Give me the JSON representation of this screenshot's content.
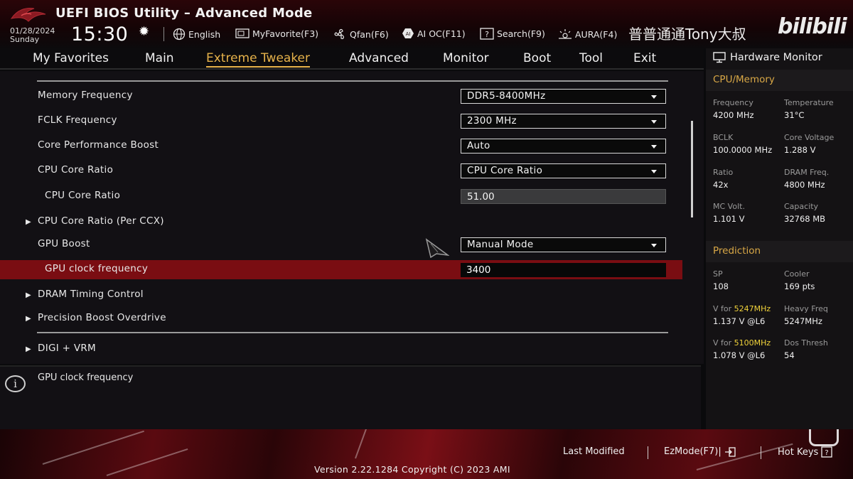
{
  "header": {
    "title": "UEFI BIOS Utility – Advanced Mode",
    "date": "01/28/2024",
    "day": "Sunday",
    "time": "15:30",
    "tools": [
      {
        "label": "English",
        "icon": "globe-icon"
      },
      {
        "label": "MyFavorite(F3)",
        "icon": "favorite-icon"
      },
      {
        "label": "Qfan(F6)",
        "icon": "fan-icon"
      },
      {
        "label": "AI OC(F11)",
        "icon": "ai-oc-icon"
      },
      {
        "label": "Search(F9)",
        "icon": "search-icon"
      },
      {
        "label": "AURA(F4)",
        "icon": "aura-icon"
      }
    ],
    "watermark": "普普通通Tony大叔",
    "watermark_logo": "bilibili"
  },
  "nav": {
    "tabs": [
      "My Favorites",
      "Main",
      "Extreme Tweaker",
      "Advanced",
      "Monitor",
      "Boot",
      "Tool",
      "Exit"
    ],
    "active": "Extreme Tweaker"
  },
  "settings": {
    "memory_frequency": {
      "label": "Memory Frequency",
      "value": "DDR5-8400MHz"
    },
    "fclk_frequency": {
      "label": "FCLK Frequency",
      "value": "2300 MHz"
    },
    "core_performance_boost": {
      "label": "Core Performance Boost",
      "value": "Auto"
    },
    "cpu_core_ratio": {
      "label": "CPU Core Ratio",
      "value": "CPU Core Ratio"
    },
    "cpu_core_ratio_sub": {
      "label": "CPU Core Ratio",
      "value": "51.00"
    },
    "cpu_core_ratio_per_ccx": {
      "label": "CPU Core Ratio (Per CCX)"
    },
    "gpu_boost": {
      "label": "GPU Boost",
      "value": "Manual Mode"
    },
    "gpu_clock_frequency": {
      "label": "GPU clock frequency",
      "value": "3400"
    },
    "dram_timing_control": {
      "label": "DRAM Timing Control"
    },
    "precision_boost_overdrive": {
      "label": "Precision Boost Overdrive"
    },
    "digi_vrm": {
      "label": "DIGI + VRM"
    }
  },
  "help": {
    "text": "GPU clock frequency"
  },
  "hardware_monitor": {
    "title": "Hardware Monitor",
    "cpu_memory": {
      "title": "CPU/Memory",
      "frequency_label": "Frequency",
      "frequency_value": "4200 MHz",
      "temperature_label": "Temperature",
      "temperature_value": "31°C",
      "bclk_label": "BCLK",
      "bclk_value": "100.0000 MHz",
      "core_voltage_label": "Core Voltage",
      "core_voltage_value": "1.288 V",
      "ratio_label": "Ratio",
      "ratio_value": "42x",
      "dram_freq_label": "DRAM Freq.",
      "dram_freq_value": "4800 MHz",
      "mc_volt_label": "MC Volt.",
      "mc_volt_value": "1.101 V",
      "capacity_label": "Capacity",
      "capacity_value": "32768 MB"
    },
    "prediction": {
      "title": "Prediction",
      "sp_label": "SP",
      "sp_value": "108",
      "cooler_label": "Cooler",
      "cooler_value": "169 pts",
      "v_for_prefix": "V for ",
      "v_for_1_freq": "5247MHz",
      "v_for_1_value": "1.137 V @L6",
      "heavy_freq_label": "Heavy Freq",
      "heavy_freq_value": "5247MHz",
      "v_for_2_freq": "5100MHz",
      "v_for_2_value": "1.078 V @L6",
      "dos_thresh_label": "Dos Thresh",
      "dos_thresh_value": "54"
    }
  },
  "footer": {
    "last_modified": "Last Modified",
    "ezmode": "EzMode(F7)|",
    "hot_keys": "Hot Keys",
    "version": "Version 2.22.1284 Copyright (C) 2023 AMI"
  },
  "colors": {
    "accent": "#e6b24a",
    "highlight_row": "#7a0d12",
    "monitor_section": "#d9a846",
    "freq_highlight": "#f0d23a"
  }
}
